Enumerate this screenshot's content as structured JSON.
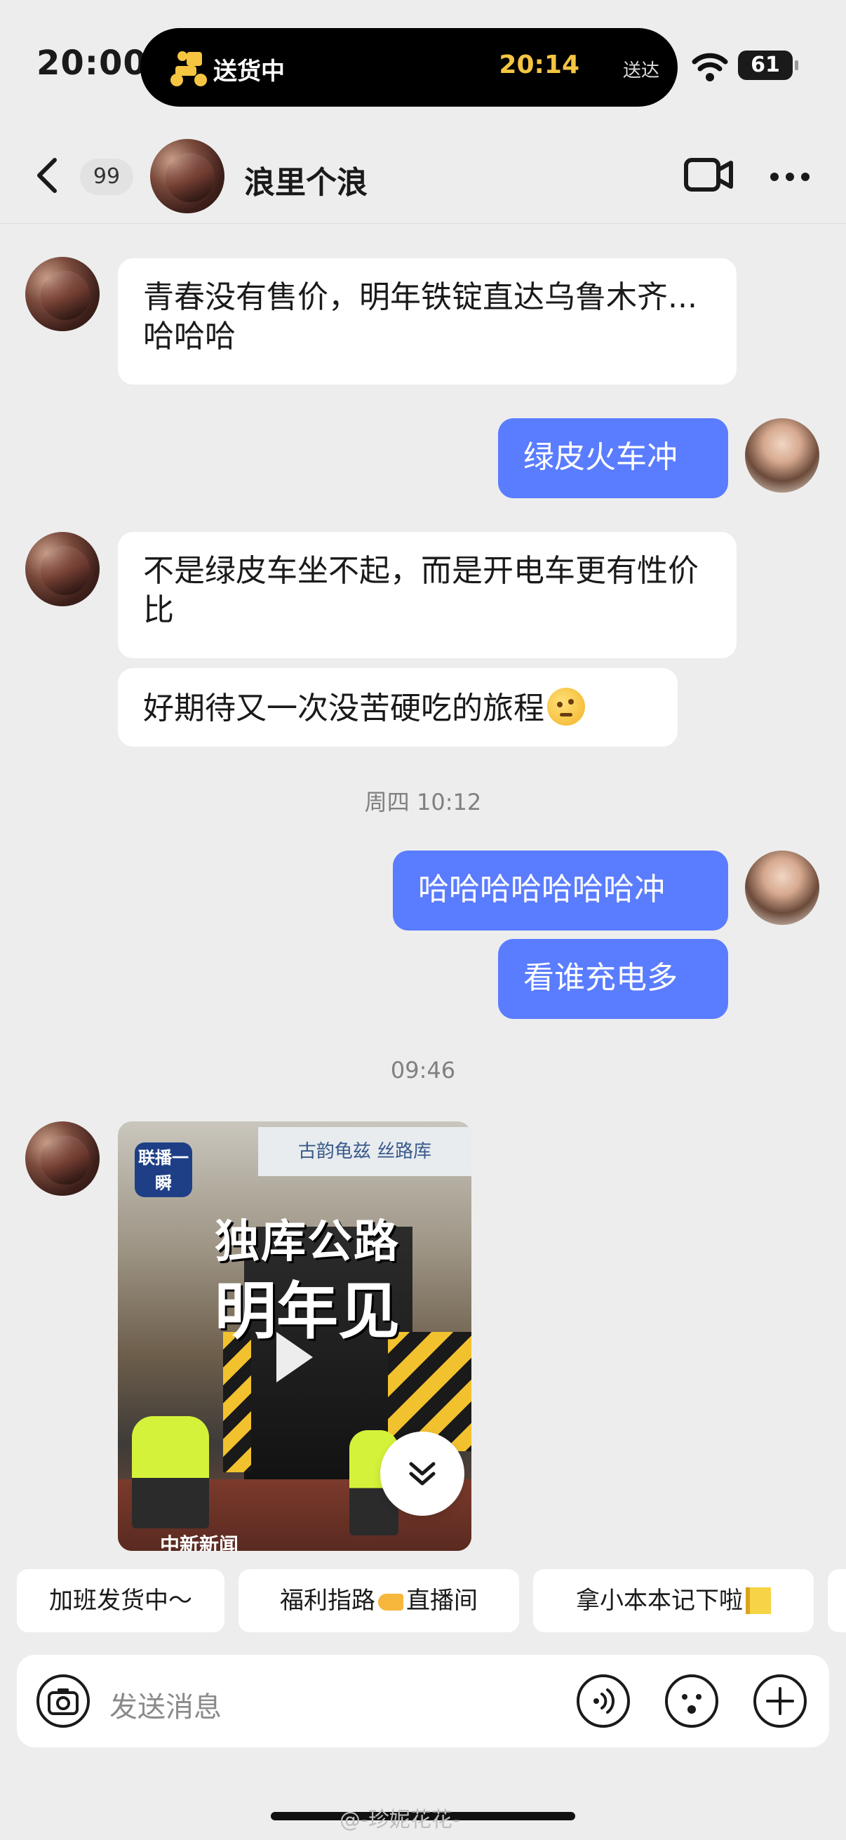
{
  "status_bar": {
    "time": "20:00",
    "island_label": "送货中",
    "eta_time": "20:14",
    "eta_suffix": "送达",
    "battery": "61"
  },
  "header": {
    "unread_count": "99",
    "contact_name": "浪里个浪"
  },
  "messages": [
    {
      "side": "in",
      "text": "青春没有售价，明年铁锭直达乌鲁木齐...哈哈哈"
    },
    {
      "side": "out",
      "text": "绿皮火车冲"
    },
    {
      "side": "in",
      "text": "不是绿皮车坐不起，而是开电车更有性价比"
    },
    {
      "side": "in",
      "text": "好期待又一次没苦硬吃的旅程"
    },
    {
      "side": "out",
      "text": "哈哈哈哈哈哈哈冲"
    },
    {
      "side": "out",
      "text": "看谁充电多"
    }
  ],
  "timestamps": [
    "周四 10:12",
    "09:46"
  ],
  "video_card": {
    "logo_text": "联播一瞬",
    "sign_text": "古韵龟兹 丝路库",
    "headline_line1": "独库公路",
    "headline_line2": "明年见",
    "source": "中新新闻"
  },
  "quick_replies": [
    {
      "label": "加班发货中～"
    },
    {
      "label_a": "福利指路",
      "label_b": "直播间"
    },
    {
      "label": "拿小本本记下啦"
    }
  ],
  "input": {
    "placeholder": "发送消息"
  },
  "watermark": "@-珍妮花花-"
}
